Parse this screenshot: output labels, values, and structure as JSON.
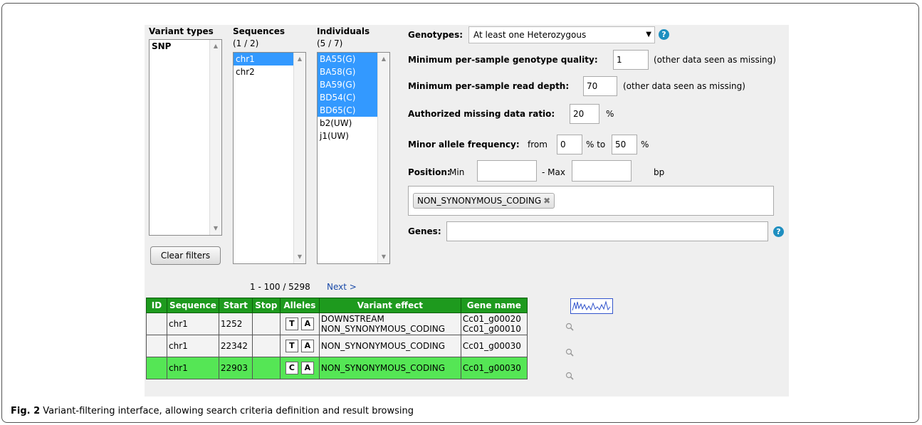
{
  "variant_types": {
    "header": "Variant types",
    "items": [
      "SNP"
    ]
  },
  "sequences": {
    "header": "Sequences",
    "count": "(1 / 2)",
    "items": [
      {
        "label": "chr1",
        "selected": true
      },
      {
        "label": "chr2",
        "selected": false
      }
    ]
  },
  "individuals": {
    "header": "Individuals",
    "count": "(5 / 7)",
    "items": [
      {
        "label": "BA55(G)",
        "selected": true
      },
      {
        "label": "BA58(G)",
        "selected": true
      },
      {
        "label": "BA59(G)",
        "selected": true
      },
      {
        "label": "BD54(C)",
        "selected": true
      },
      {
        "label": "BD65(C)",
        "selected": true
      },
      {
        "label": "b2(UW)",
        "selected": false
      },
      {
        "label": "j1(UW)",
        "selected": false
      }
    ]
  },
  "clear_filters_label": "Clear filters",
  "filters": {
    "genotypes_label": "Genotypes:",
    "genotypes_value": "At least one Heterozygous",
    "min_gq_label": "Minimum per-sample genotype quality:",
    "min_gq_value": "1",
    "min_gq_note": "(other data seen as missing)",
    "min_dp_label": "Minimum per-sample read depth:",
    "min_dp_value": "70",
    "min_dp_note": "(other data seen as missing)",
    "missing_label": "Authorized missing data ratio:",
    "missing_value": "20",
    "missing_unit": "%",
    "maf_label": "Minor allele frequency:",
    "maf_from": "from",
    "maf_min": "0",
    "maf_to": "% to",
    "maf_max": "50",
    "maf_unit": "%",
    "position_label": "Position:",
    "position_min_label": "Min",
    "position_min_value": "",
    "position_max_label": "- Max",
    "position_max_value": "",
    "position_unit": "bp",
    "effect_tag": "NON_SYNONYMOUS_CODING",
    "genes_label": "Genes:",
    "genes_value": ""
  },
  "help_glyph": "?",
  "pagination": {
    "range": "1 - 100 / 5298",
    "next": "Next >"
  },
  "table": {
    "headers": [
      "ID",
      "Sequence",
      "Start",
      "Stop",
      "Alleles",
      "Variant effect",
      "Gene name"
    ],
    "rows": [
      {
        "id": "",
        "sequence": "chr1",
        "start": "1252",
        "stop": "",
        "ref": "T",
        "alt": "A",
        "effect1": "DOWNSTREAM",
        "effect2": "NON_SYNONYMOUS_CODING",
        "gene1": "Cc01_g00020",
        "gene2": "Cc01_g00010",
        "highlight": false
      },
      {
        "id": "",
        "sequence": "chr1",
        "start": "22342",
        "stop": "",
        "ref": "T",
        "alt": "A",
        "effect1": "NON_SYNONYMOUS_CODING",
        "effect2": "",
        "gene1": "Cc01_g00030",
        "gene2": "",
        "highlight": false
      },
      {
        "id": "",
        "sequence": "chr1",
        "start": "22903",
        "stop": "",
        "ref": "C",
        "alt": "A",
        "effect1": "NON_SYNONYMOUS_CODING",
        "effect2": "",
        "gene1": "Cc01_g00030",
        "gene2": "",
        "highlight": true
      }
    ]
  },
  "colors": {
    "selection": "#3399ff",
    "table_header": "#1e9a1e",
    "highlight_row": "#55e655",
    "help_icon": "#1f8fc0",
    "link": "#1a4aa8"
  },
  "icons": {
    "help": "help-icon",
    "magnifier": "magnifier-icon",
    "chart": "density-chart-icon",
    "remove": "remove-tag-icon"
  },
  "caption": {
    "label": "Fig. 2",
    "text": "Variant-filtering interface, allowing search criteria definition and result browsing"
  }
}
